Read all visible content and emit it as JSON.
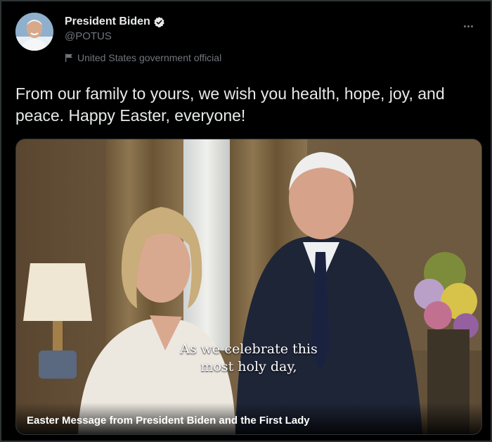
{
  "author": {
    "display_name": "President Biden",
    "handle": "@POTUS",
    "label": "United States government official",
    "avatar_icon": "portrait-avatar",
    "verified_icon": "verified-badge-icon"
  },
  "tweet": {
    "text": "From our family to yours, we wish you health, hope, joy, and peace. Happy Easter, everyone!"
  },
  "media": {
    "caption_line1": "As we celebrate this",
    "caption_line2": "most holy day,",
    "title": "Easter Message from President Biden and the First Lady"
  },
  "colors": {
    "background": "#000000",
    "text": "#e7e9ea",
    "secondary_text": "#71767b",
    "border": "#2f3336"
  }
}
